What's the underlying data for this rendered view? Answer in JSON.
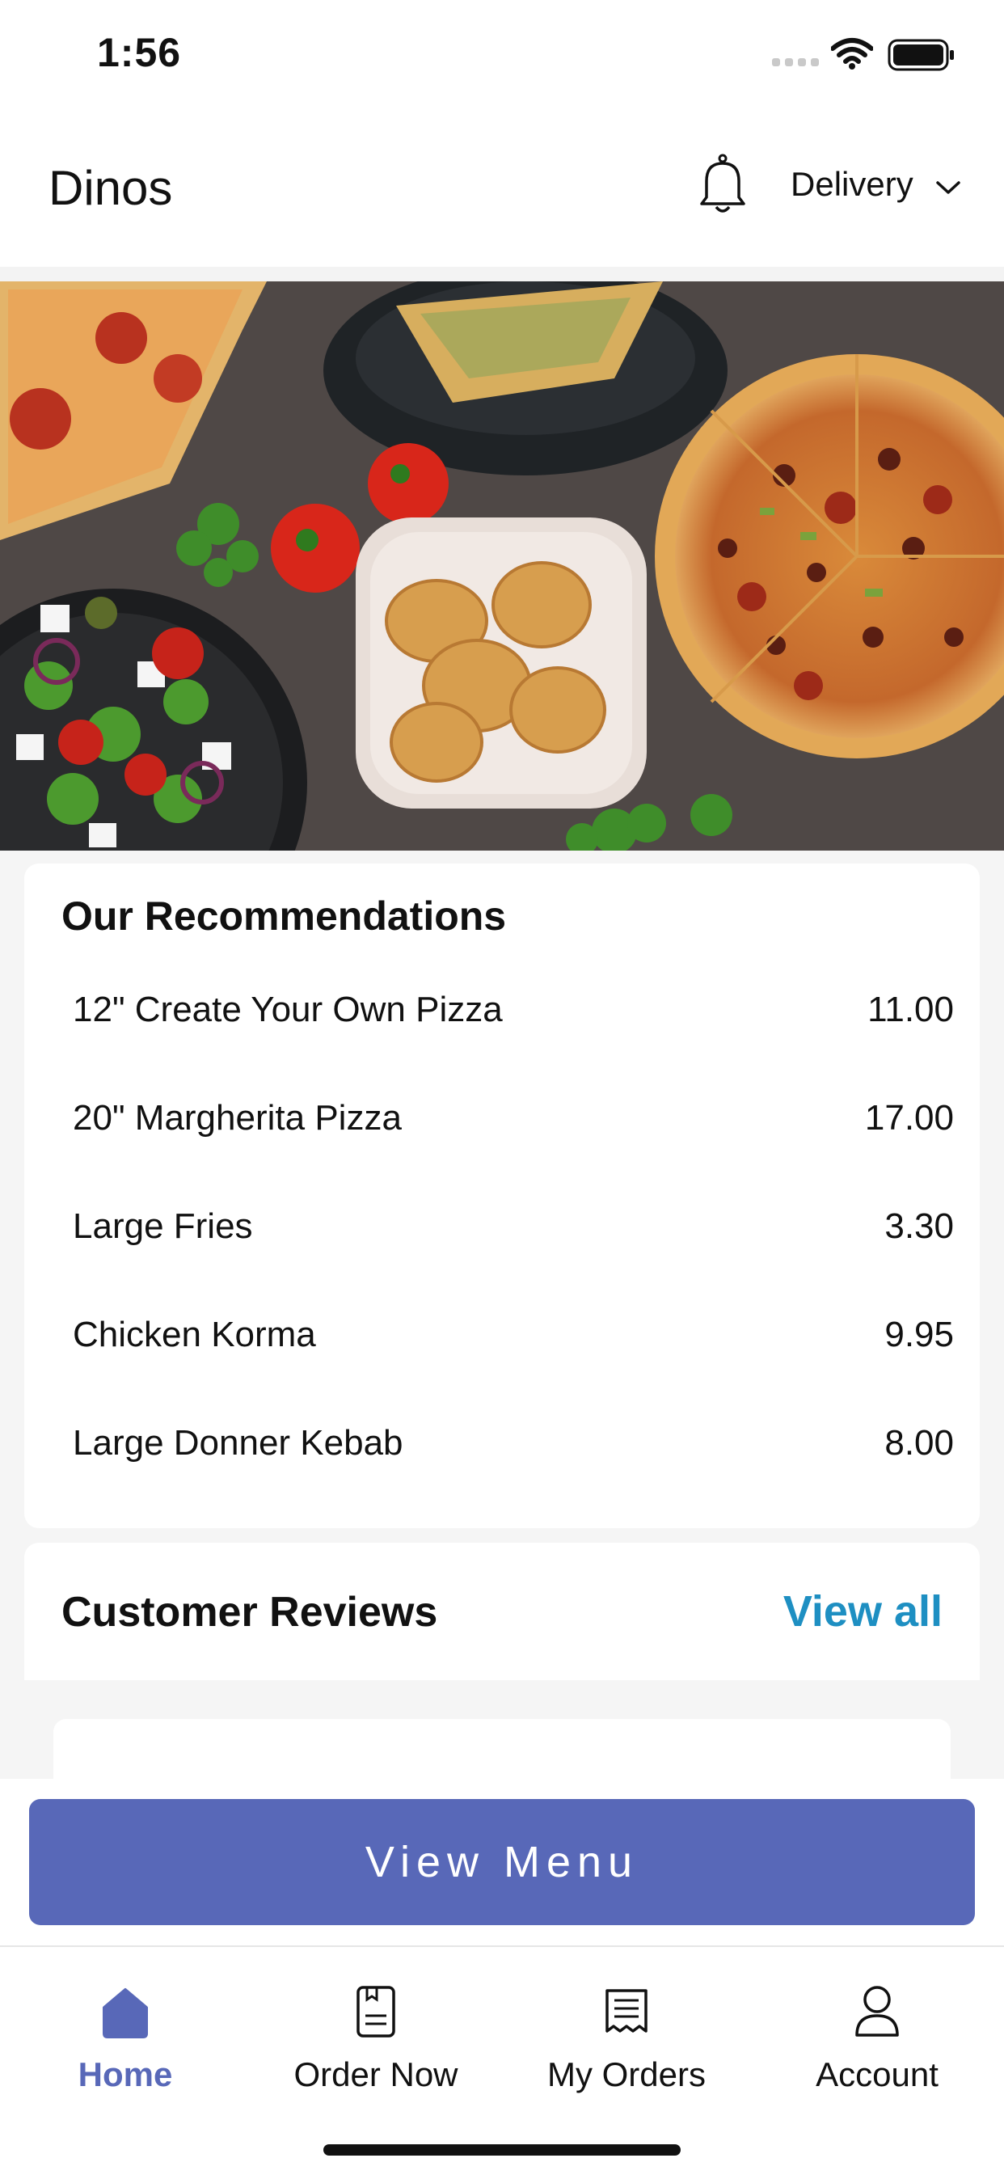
{
  "status_bar": {
    "time": "1:56"
  },
  "header": {
    "title": "Dinos",
    "mode": "Delivery"
  },
  "recommendations": {
    "title": "Our Recommendations",
    "items": [
      {
        "name": "12\" Create Your Own Pizza",
        "price": "11.00"
      },
      {
        "name": "20\" Margherita Pizza",
        "price": "17.00"
      },
      {
        "name": "Large Fries",
        "price": "3.30"
      },
      {
        "name": "Chicken Korma",
        "price": "9.95"
      },
      {
        "name": "Large Donner Kebab",
        "price": "8.00"
      }
    ]
  },
  "reviews": {
    "title": "Customer Reviews",
    "view_all": "View all"
  },
  "cta": {
    "label": "View Menu"
  },
  "tabs": [
    {
      "label": "Home"
    },
    {
      "label": "Order Now"
    },
    {
      "label": "My Orders"
    },
    {
      "label": "Account"
    }
  ],
  "colors": {
    "accent": "#5868b8",
    "link": "#1e8fc2"
  }
}
